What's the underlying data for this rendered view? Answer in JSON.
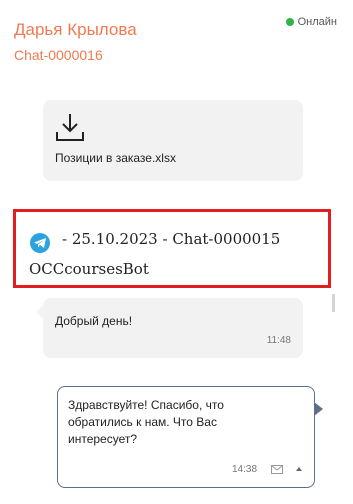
{
  "header": {
    "contact_name": "Дарья Крылова",
    "chat_id": "Chat-0000016",
    "status": "Онлайн"
  },
  "file_message": {
    "file_name": "Позиции в заказе.xlsx",
    "icon": "download-icon"
  },
  "separator": {
    "icon": "telegram-icon",
    "text": "- 25.10.2023 - Chat-0000015",
    "bot_name": "OCCcoursesBot"
  },
  "incoming_message": {
    "text": "Добрый день!",
    "time": "11:48"
  },
  "outgoing_message": {
    "text": "Здравствуйте! Спасибо, что обратились к нам. Что Вас интересует?",
    "time": "14:38",
    "icons": [
      "envelope-icon",
      "caret-up-icon"
    ]
  },
  "colors": {
    "accent": "#f07a52",
    "online": "#32b34a",
    "highlight_border": "#e01e1e",
    "telegram": "#2aa3df",
    "outgoing_border": "#5b6e8a",
    "bubble_bg": "#f2f2f2"
  }
}
